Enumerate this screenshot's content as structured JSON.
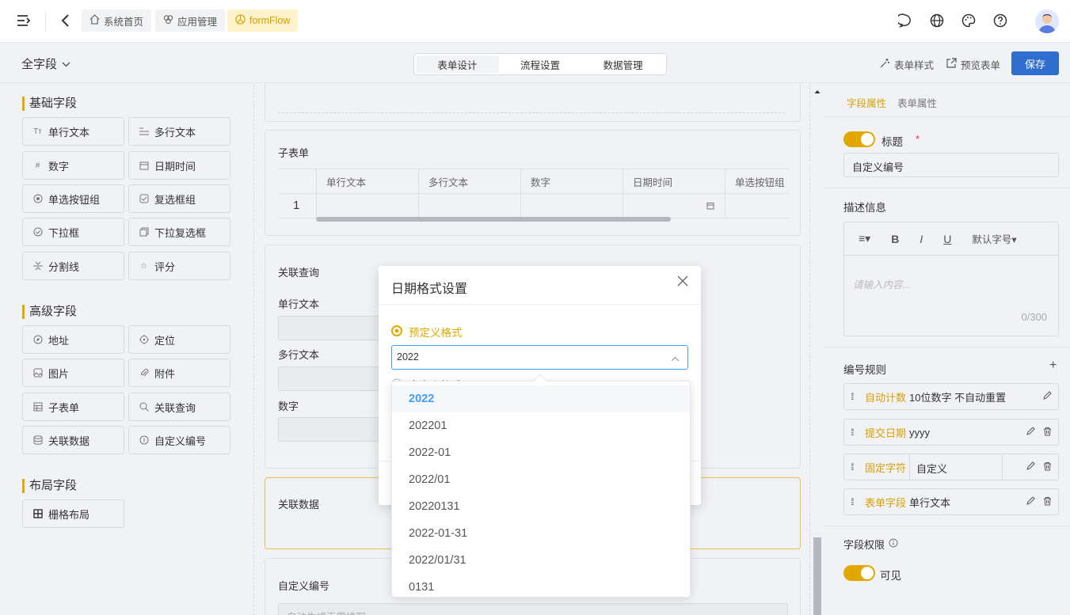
{
  "topbar": {
    "breadcrumbs": [
      {
        "label": "系统首页",
        "icon": "home-icon"
      },
      {
        "label": "应用管理",
        "icon": "apps-icon"
      },
      {
        "label": "formFlow",
        "icon": "flow-icon"
      }
    ]
  },
  "subbar": {
    "field_scope": "全字段",
    "tabs": [
      "表单设计",
      "流程设置",
      "数据管理"
    ],
    "active_tab": "表单设计",
    "form_style": "表单样式",
    "preview": "预览表单",
    "save": "保存"
  },
  "left": {
    "basic_title": "基础字段",
    "basic": [
      {
        "label": "单行文本",
        "icon": "text-icon"
      },
      {
        "label": "多行文本",
        "icon": "textarea-icon"
      },
      {
        "label": "数字",
        "icon": "hash-icon"
      },
      {
        "label": "日期时间",
        "icon": "calendar-icon"
      },
      {
        "label": "单选按钮组",
        "icon": "radio-icon"
      },
      {
        "label": "复选框组",
        "icon": "checkbox-icon"
      },
      {
        "label": "下拉框",
        "icon": "select-icon"
      },
      {
        "label": "下拉复选框",
        "icon": "multiselect-icon"
      },
      {
        "label": "分割线",
        "icon": "divider-icon"
      },
      {
        "label": "评分",
        "icon": "star-icon"
      }
    ],
    "advanced_title": "高级字段",
    "advanced": [
      {
        "label": "地址",
        "icon": "compass-icon"
      },
      {
        "label": "定位",
        "icon": "location-icon"
      },
      {
        "label": "图片",
        "icon": "image-icon"
      },
      {
        "label": "附件",
        "icon": "attach-icon"
      },
      {
        "label": "子表单",
        "icon": "table-icon"
      },
      {
        "label": "关联查询",
        "icon": "search-icon"
      },
      {
        "label": "关联数据",
        "icon": "database-icon"
      },
      {
        "label": "自定义编号",
        "icon": "number-icon"
      }
    ],
    "layout_title": "布局字段",
    "layout": [
      {
        "label": "栅格布局",
        "icon": "grid-icon"
      }
    ]
  },
  "canvas": {
    "subform": {
      "title": "子表单",
      "columns": [
        "单行文本",
        "多行文本",
        "数字",
        "日期时间",
        "单选按钮组"
      ],
      "row_index": "1"
    },
    "lookup": {
      "title": "关联查询",
      "fields": [
        "单行文本",
        "多行文本",
        "数字"
      ]
    },
    "reldata": {
      "title": "关联数据"
    },
    "autonum": {
      "title": "自定义编号",
      "placeholder": "自动生成无需填写"
    }
  },
  "right": {
    "tabs": [
      "字段属性",
      "表单属性"
    ],
    "title_label": "标题",
    "title_value": "自定义编号",
    "desc_label": "描述信息",
    "editor_font": "默认字号",
    "desc_placeholder": "请输入内容...",
    "desc_count": "0/300",
    "rules_label": "编号规则",
    "rules": [
      {
        "key": "自动计数",
        "value": "10位数字 不自动重置"
      },
      {
        "key": "提交日期",
        "value": "yyyy"
      },
      {
        "key": "固定字符",
        "value": "自定义"
      },
      {
        "key": "表单字段",
        "value": "单行文本"
      }
    ],
    "perm_label": "字段权限",
    "perm_visible": "可见"
  },
  "modal": {
    "title": "日期格式设置",
    "radio_predef": "预定义格式",
    "selected": "2022",
    "radio_custom": "自定义格式",
    "options": [
      "2022",
      "202201",
      "2022-01",
      "2022/01",
      "20220131",
      "2022-01-31",
      "2022/01/31",
      "0131"
    ]
  },
  "colors": {
    "accent": "#e0a800",
    "primary": "#2f6ecf",
    "selected_option": "#409eff"
  }
}
